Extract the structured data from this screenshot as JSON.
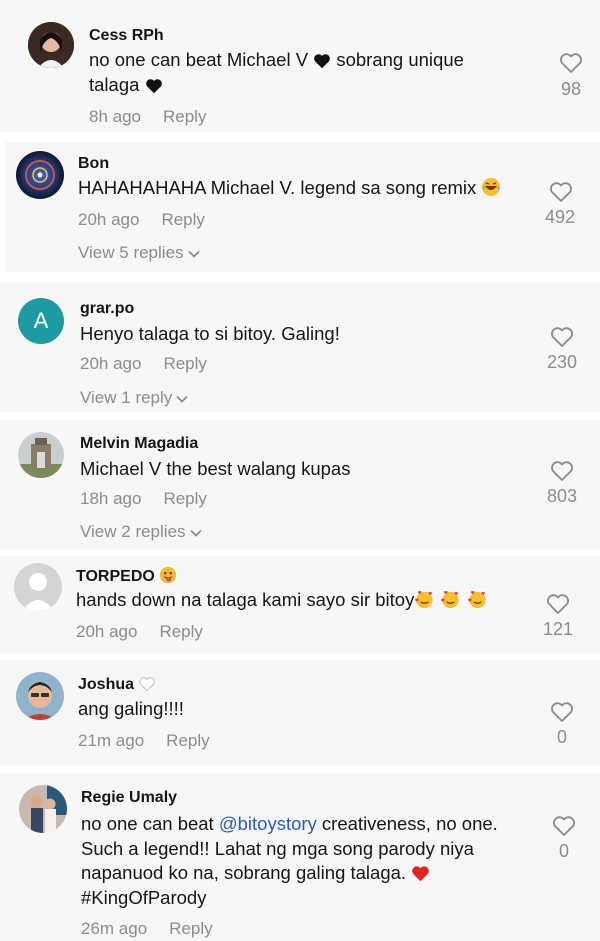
{
  "comments": [
    {
      "user": "Cess RPh",
      "text1": "no one can beat Michael V",
      "text2": "sobrang unique",
      "text3": "talaga",
      "time": "8h ago",
      "reply": "Reply",
      "likes": "98",
      "avatar_icon": "user-photo"
    },
    {
      "user": "Bon",
      "text": "HAHAHAHAHA Michael V. legend sa song remix",
      "time": "20h ago",
      "reply": "Reply",
      "likes": "492",
      "view": "View 5 replies",
      "emoji_icon": "laughing-emoji"
    },
    {
      "user": "grar.po",
      "text": "Henyo talaga to si bitoy. Galing!",
      "time": "20h ago",
      "reply": "Reply",
      "likes": "230",
      "view": "View 1 reply",
      "avatar_letter": "A"
    },
    {
      "user": "Melvin Magadia",
      "text": "Michael V the best walang kupas",
      "time": "18h ago",
      "reply": "Reply",
      "likes": "803",
      "view": "View 2 replies"
    },
    {
      "user": "TORPEDO",
      "text": "hands down na talaga kami sayo sir bitoy",
      "time": "20h ago",
      "reply": "Reply",
      "likes": "121",
      "emoji_icon": "heart-face-emoji"
    },
    {
      "user": "Joshua",
      "text": "ang galing!!!!",
      "time": "21m ago",
      "reply": "Reply",
      "likes": "0"
    },
    {
      "user": "Regie Umaly",
      "line1a": "no one can beat ",
      "mention": "@bitoystory",
      "line1b": " creativeness, no one.",
      "line2": "Such a legend!! Lahat ng mga song parody niya",
      "line3": "napanuod ko na, sobrang galing talaga.",
      "line4": "#KingOfParody",
      "time": "26m ago",
      "reply": "Reply",
      "likes": "0"
    }
  ],
  "colors": {
    "card_bg": "#f7f7f7",
    "muted": "#8c8c8c",
    "text": "#161616",
    "mention": "#2b5db5",
    "avatar_teal": "#1e9aa3"
  }
}
